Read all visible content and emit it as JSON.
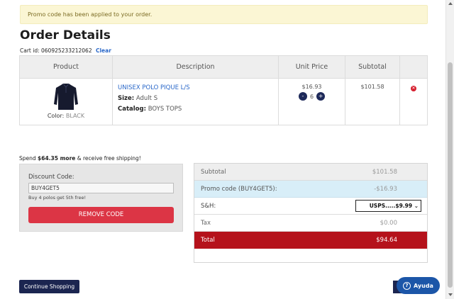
{
  "alert": {
    "message": "Promo code has been applied to your order."
  },
  "page": {
    "title": "Order Details",
    "cart_id_label": "Cart id:",
    "cart_id": "060925233212062",
    "clear_label": "Clear"
  },
  "table": {
    "headers": [
      "Product",
      "Description",
      "Unit Price",
      "Subtotal",
      ""
    ],
    "item": {
      "color_label": "Color:",
      "color_value": "BLACK",
      "name": "UNISEX POLO PIQUE L/S",
      "size_label": "Size:",
      "size_value": "Adult S",
      "catalog_label": "Catalog:",
      "catalog_value": "BOYS TOPS",
      "unit_price": "$16.93",
      "qty_minus": "-",
      "quantity": "6",
      "qty_plus": "+",
      "subtotal": "$101.58"
    }
  },
  "shipping_note": {
    "prefix": "Spend",
    "amount": "$64.35 more",
    "suffix": "& receive free shipping!"
  },
  "discount": {
    "label": "Discount Code:",
    "value": "BUY4GET5",
    "hint": "Buy 4 polos get 5th free!",
    "remove_label": "REMOVE CODE"
  },
  "summary": {
    "subtotal_label": "Subtotal",
    "subtotal_value": "$101.58",
    "promo_label": "Promo code (BUY4GET5):",
    "promo_value": "-$16.93",
    "sh_label": "S&H:",
    "sh_selected": "USPS.....$9.99",
    "tax_label": "Tax",
    "tax_value": "$0.00",
    "total_label": "Total",
    "total_value": "$94.64"
  },
  "buttons": {
    "continue_label": "Continue Shopping",
    "help_label": "Ayuda"
  },
  "colors": {
    "accent_red": "#dc3545",
    "total_red": "#b5121b",
    "navy": "#1b2550",
    "help_blue": "#1c56a8"
  }
}
